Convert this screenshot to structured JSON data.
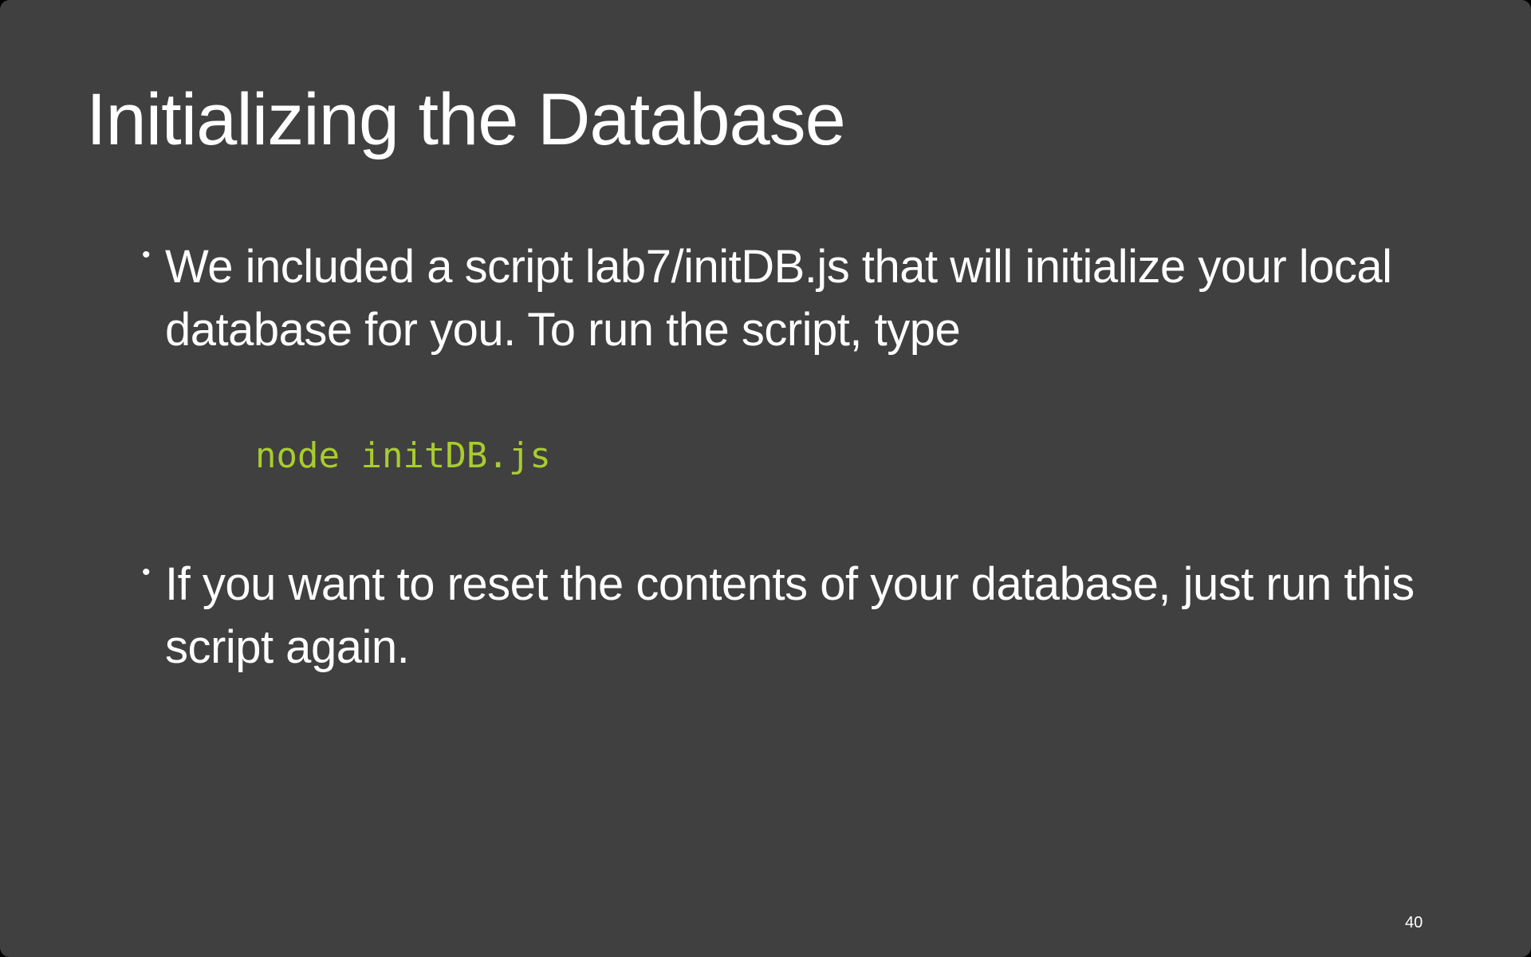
{
  "slide": {
    "title": "Initializing the Database",
    "bullets": [
      {
        "marker": "•",
        "text": "We included a script lab7/initDB.js that will initialize your local database for you.  To run the script, type"
      },
      {
        "marker": "•",
        "text": "If you want to reset the contents of your database, just run this script again."
      }
    ],
    "code": "node initDB.js",
    "page_number": "40"
  },
  "colors": {
    "background": "#404040",
    "text": "#ffffff",
    "code": "#a9cc2e"
  }
}
